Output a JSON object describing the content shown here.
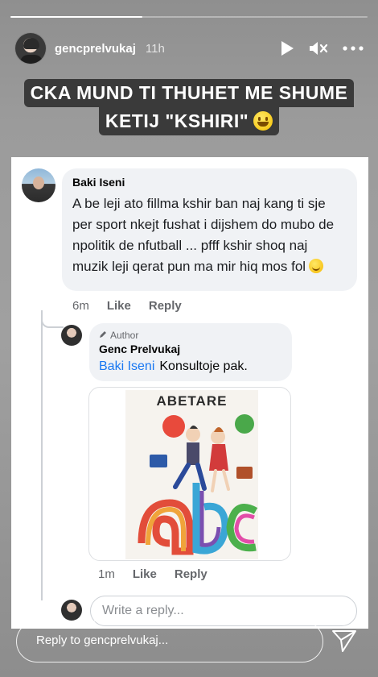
{
  "story": {
    "progress": 0.37,
    "username": "gencprelvukaj",
    "time_ago": "11h",
    "caption_line1": "CKA MUND TI THUHET ME SHUME",
    "caption_line2": "KETIJ \"KSHIRI\"",
    "reply_placeholder": "Reply to gencprelvukaj..."
  },
  "comments": {
    "first": {
      "author": "Baki Iseni",
      "text": "A be leji ato fillma kshir ban naj kang ti sje per sport nkejt fushat i dijshem do mubo de npolitik de nfutball ... pfff kshir shoq naj muzik leji qerat pun ma mir hiq mos fol",
      "time": "6m",
      "like": "Like",
      "reply": "Reply"
    },
    "second": {
      "badge": "Author",
      "author": "Genc Prelvukaj",
      "mention": "Baki Iseni",
      "text": "Konsultoje pak.",
      "image_title": "ABETARE",
      "time": "1m",
      "like": "Like",
      "reply": "Reply"
    },
    "write_placeholder": "Write a reply..."
  },
  "icons": [
    "play-icon",
    "mute-icon",
    "more-icon",
    "pencil-icon",
    "send-icon"
  ],
  "colors": {
    "link": "#1877f2",
    "bubble": "#f0f2f5",
    "muted": "#65676b",
    "caption_bg": "#3a3a3a"
  }
}
